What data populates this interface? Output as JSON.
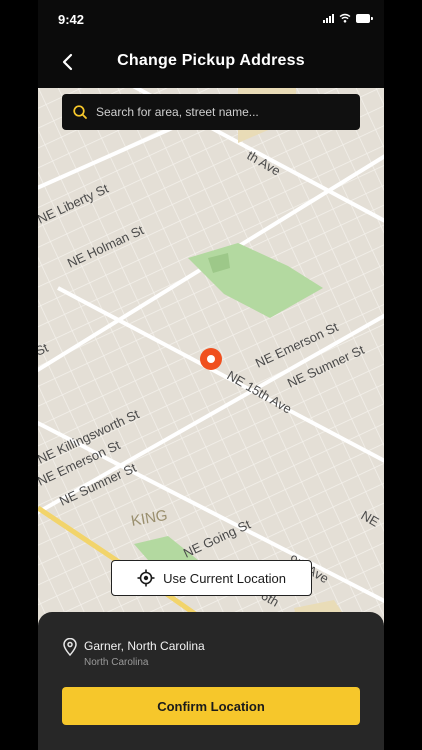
{
  "status_bar": {
    "time": "9:42"
  },
  "header": {
    "title": "Change Pickup Address",
    "back_icon": "chevron-left-icon"
  },
  "search": {
    "placeholder": "Search for area, street name...",
    "icon": "search-icon"
  },
  "map": {
    "streets": [
      "NE Liberty St",
      "NE Holman St",
      "NE Emerson St",
      "NE Sumner St",
      "NE 15th Ave",
      "NE Killingsworth St",
      "NE Emerson St",
      "NE Sumner St",
      "KING",
      "NE Going St",
      "th Ave",
      "9th Ave",
      "6th",
      "St",
      "NE"
    ],
    "pin_icon": "map-pin-icon"
  },
  "current_location": {
    "label": "Use Current Location",
    "icon": "crosshair-icon"
  },
  "selected_location": {
    "title": "Garner, North Carolina",
    "subtitle": "North Carolina",
    "icon": "location-pin-icon"
  },
  "confirm": {
    "label": "Confirm Location"
  },
  "colors": {
    "accent": "#F6C72B",
    "pin": "#F0501E",
    "park": "#A9D394",
    "sheet": "#272727"
  }
}
